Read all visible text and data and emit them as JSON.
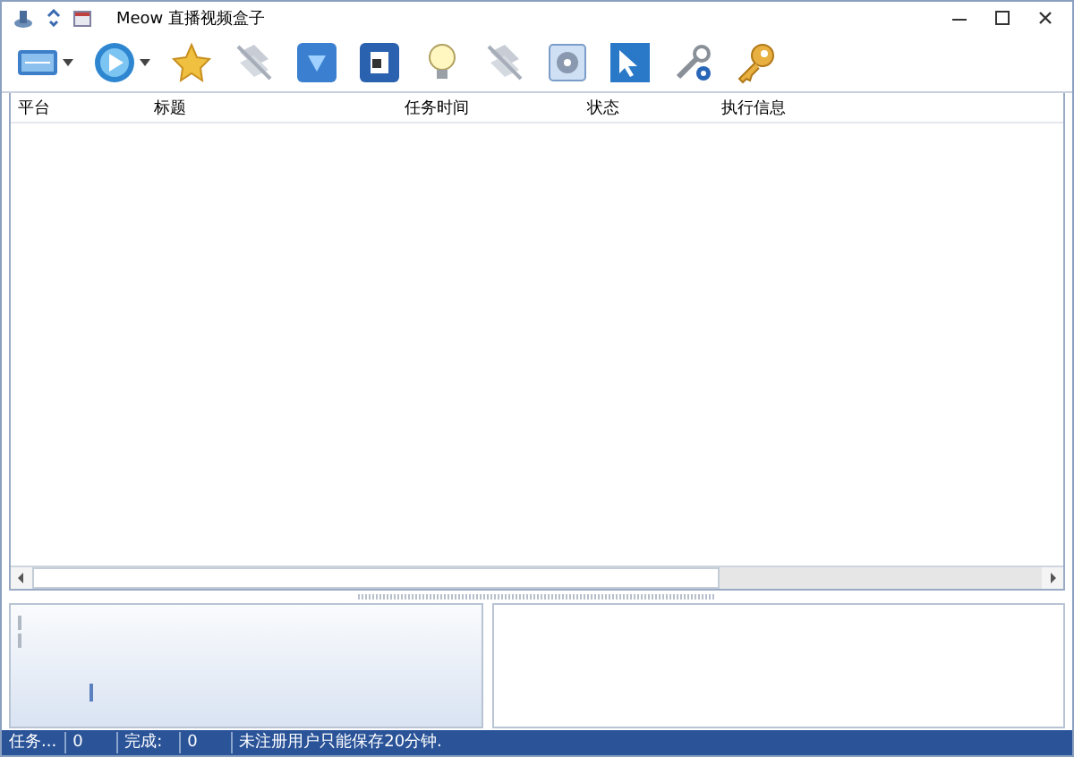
{
  "window": {
    "title": "Meow 直播视频盒子"
  },
  "toolbar": [
    {
      "kind": "dropdown",
      "disabled": false
    },
    {
      "kind": "dropdown",
      "disabled": false
    },
    {
      "kind": "button",
      "disabled": false
    },
    {
      "kind": "button",
      "disabled": true
    },
    {
      "kind": "button",
      "disabled": false
    },
    {
      "kind": "button",
      "disabled": false
    },
    {
      "kind": "button",
      "disabled": false
    },
    {
      "kind": "button",
      "disabled": true
    },
    {
      "kind": "button",
      "disabled": false
    },
    {
      "kind": "button",
      "disabled": false
    },
    {
      "kind": "button",
      "disabled": false
    },
    {
      "kind": "button",
      "disabled": false
    }
  ],
  "table": {
    "columns": [
      "平台",
      "标题",
      "任务时间",
      "状态",
      "执行信息"
    ]
  },
  "status_bar": [
    "任务...",
    "0",
    "完成:",
    "0",
    "未注册用户只能保存20分钟."
  ]
}
